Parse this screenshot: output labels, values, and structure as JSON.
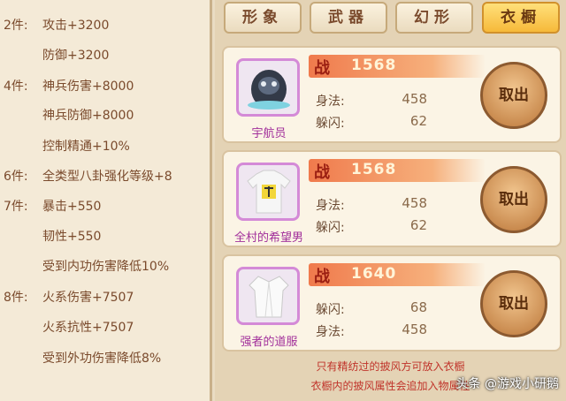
{
  "set_bonuses": [
    {
      "tier": "2件:",
      "text": "攻击+3200"
    },
    {
      "tier": "",
      "text": "防御+3200"
    },
    {
      "tier": "4件:",
      "text": "神兵伤害+8000"
    },
    {
      "tier": "",
      "text": "神兵防御+8000"
    },
    {
      "tier": "",
      "text": "控制精通+10%"
    },
    {
      "tier": "6件:",
      "text": "全类型八卦强化等级+8"
    },
    {
      "tier": "7件:",
      "text": "暴击+550"
    },
    {
      "tier": "",
      "text": "韧性+550"
    },
    {
      "tier": "",
      "text": "受到内功伤害降低10%"
    },
    {
      "tier": "8件:",
      "text": "火系伤害+7507"
    },
    {
      "tier": "",
      "text": "火系抗性+7507"
    },
    {
      "tier": "",
      "text": "受到外功伤害降低8%"
    }
  ],
  "tabs": [
    {
      "label": "形象",
      "active": false
    },
    {
      "label": "武器",
      "active": false
    },
    {
      "label": "幻形",
      "active": false
    },
    {
      "label": "衣橱",
      "active": true
    }
  ],
  "wardrobe_items": [
    {
      "name": "宇航员",
      "power_label": "战",
      "power": "1568",
      "stats": [
        {
          "name": "身法:",
          "value": "458"
        },
        {
          "name": "躲闪:",
          "value": "62"
        }
      ],
      "button": "取出"
    },
    {
      "name": "全村的希望男",
      "power_label": "战",
      "power": "1568",
      "stats": [
        {
          "name": "身法:",
          "value": "458"
        },
        {
          "name": "躲闪:",
          "value": "62"
        }
      ],
      "button": "取出"
    },
    {
      "name": "强者的道服",
      "power_label": "战",
      "power": "1640",
      "stats": [
        {
          "name": "躲闪:",
          "value": "68"
        },
        {
          "name": "身法:",
          "value": "458"
        }
      ],
      "button": "取出"
    }
  ],
  "footer": {
    "line1": "只有精纺过的披风方可放入衣橱",
    "line2": "衣橱内的披风属性会追加入物属性"
  },
  "watermark": "头条 @游戏小研鹅",
  "colors": {
    "tab_active": "#f6b93a",
    "power_bar": "#f07a4c",
    "item_name": "#a2309b",
    "portrait_border": "#d48ad7",
    "note_red": "#c0332a"
  }
}
